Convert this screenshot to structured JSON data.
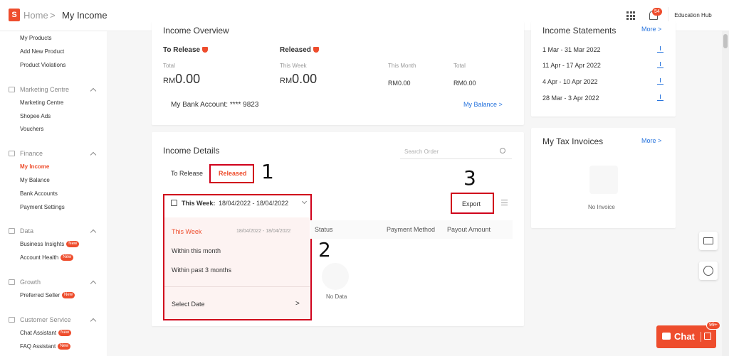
{
  "header": {
    "logo_letter": "S",
    "breadcrumb_home": "Home",
    "breadcrumb_sep": ">",
    "breadcrumb_current": "My Income",
    "notification_count": "54",
    "education_hub": "Education Hub"
  },
  "sidebar": {
    "top_items": [
      "My Products",
      "Add New Product",
      "Product Violations"
    ],
    "sections": [
      {
        "title": "Marketing Centre",
        "items": [
          "Marketing Centre",
          "Shopee Ads",
          "Vouchers"
        ]
      },
      {
        "title": "Finance",
        "items": [
          "My Income",
          "My Balance",
          "Bank Accounts",
          "Payment Settings"
        ]
      },
      {
        "title": "Data",
        "items": [
          "Business Insights",
          "Account Health"
        ]
      },
      {
        "title": "Growth",
        "items": [
          "Preferred Seller"
        ]
      },
      {
        "title": "Customer Service",
        "items": [
          "Chat Assistant",
          "FAQ Assistant"
        ]
      }
    ],
    "new_label": "New"
  },
  "overview": {
    "title": "Income Overview",
    "to_release_label": "To Release",
    "released_label": "Released",
    "total_label": "Total",
    "this_week_label": "This Week",
    "this_month_label": "This Month",
    "currency": "RM",
    "to_release_total": "0.00",
    "released_this_week": "0.00",
    "released_this_month": "RM0.00",
    "released_total": "RM0.00",
    "bank_account": "My Bank Account: **** 9823",
    "my_balance_link": "My Balance >"
  },
  "statements": {
    "title": "Income Statements",
    "more": "More >",
    "items": [
      "1 Mar - 31 Mar 2022",
      "11 Apr - 17 Apr 2022",
      "4 Apr - 10 Apr 2022",
      "28 Mar - 3 Apr 2022"
    ]
  },
  "tax": {
    "title": "My Tax Invoices",
    "more": "More >",
    "empty": "No Invoice"
  },
  "details": {
    "title": "Income Details",
    "search_placeholder": "Search Order",
    "tab_to_release": "To Release",
    "tab_released": "Released",
    "date_label": "This Week:",
    "date_range": "18/04/2022 - 18/04/2022",
    "export": "Export",
    "columns": [
      "Status",
      "Payment Method",
      "Payout Amount"
    ],
    "no_data": "No Data"
  },
  "date_dropdown": {
    "options": [
      "This Week",
      "Within this month",
      "Within past 3 months"
    ],
    "this_week_range": "18/04/2022 - 18/04/2022",
    "select_date": "Select Date",
    "select_arrow": ">"
  },
  "annotations": {
    "one": "1",
    "two": "2",
    "three": "3"
  },
  "chat": {
    "label": "Chat",
    "badge": "99+"
  },
  "colors": {
    "accent": "#ee4d2d",
    "link": "#2673dd",
    "annotation_box": "#d0011b"
  }
}
